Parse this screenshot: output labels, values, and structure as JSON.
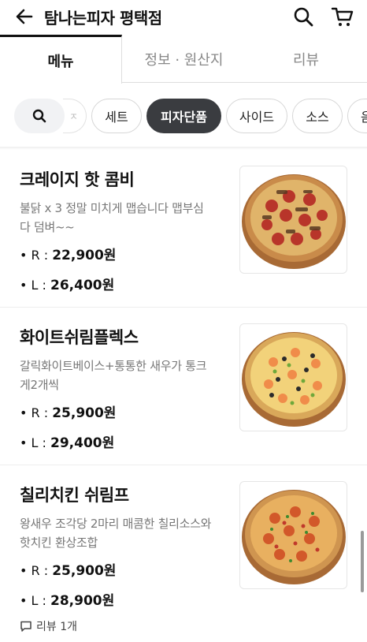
{
  "header": {
    "title": "탐나는피자 평택점",
    "back_icon": "back-arrow-icon",
    "search_icon": "search-icon",
    "cart_icon": "cart-icon"
  },
  "tabs": [
    {
      "label": "메뉴",
      "active": true
    },
    {
      "label": "정보 · 원산지",
      "active": false
    },
    {
      "label": "리뷰",
      "active": false
    }
  ],
  "chips": {
    "search_icon": "search-icon",
    "partial_label": "ㅈ",
    "items": [
      {
        "label": "세트",
        "active": false
      },
      {
        "label": "피자단품",
        "active": true
      },
      {
        "label": "사이드",
        "active": false
      },
      {
        "label": "소스",
        "active": false
      },
      {
        "label": "음",
        "active": false
      }
    ]
  },
  "menu": [
    {
      "name": "크레이지 핫 콤비",
      "desc_lines": [
        "불닭 x 3 정말 미치게 맵습니다 맵부심",
        "다 덤벼~~"
      ],
      "prices": [
        {
          "label": "• R : ",
          "value": "22,900원"
        },
        {
          "label": "• L : ",
          "value": "26,400원"
        }
      ],
      "image": "pizza-pepperoni"
    },
    {
      "name": "화이트쉬림플렉스",
      "desc_lines": [
        "갈릭화이트베이스+통통한 새우가 통크",
        "게2개씩"
      ],
      "prices": [
        {
          "label": "• R : ",
          "value": "25,900원"
        },
        {
          "label": "• L : ",
          "value": "29,400원"
        }
      ],
      "image": "pizza-white-shrimp"
    },
    {
      "name": "칠리치킨 쉬림프",
      "desc_lines": [
        "왕새우 조각당 2마리 매콤한 칠리소스와",
        "핫치킨 환상조합"
      ],
      "prices": [
        {
          "label": "• R : ",
          "value": "25,900원"
        },
        {
          "label": "• L : ",
          "value": "28,900원"
        }
      ],
      "image": "pizza-chili-shrimp",
      "review": "리뷰 1개"
    }
  ],
  "colors": {
    "active_chip": "#3a3c40",
    "text": "#111111",
    "muted": "#777777"
  }
}
